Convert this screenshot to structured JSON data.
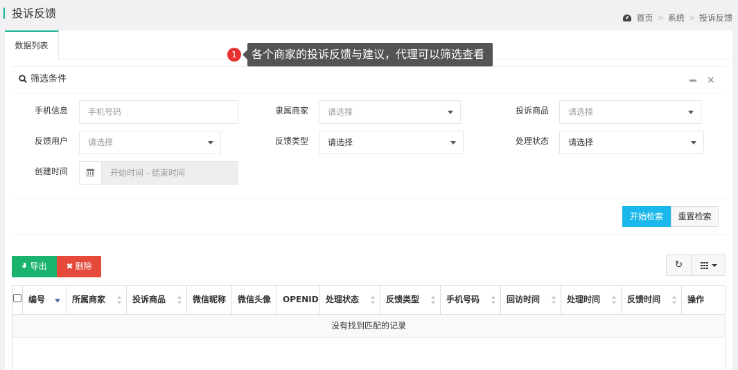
{
  "header": {
    "page_title": "投诉反馈",
    "breadcrumb": [
      "首页",
      "系统",
      "投诉反馈"
    ],
    "breadcrumb_sep": ">"
  },
  "tabs": [
    {
      "label": "数据列表"
    }
  ],
  "tooltip": {
    "badge": "1",
    "text": "各个商家的投诉反馈与建议，代理可以筛选查看"
  },
  "filter": {
    "title": "筛选条件",
    "minimize": "—",
    "close": "×",
    "fields": {
      "phone": {
        "label": "手机信息",
        "placeholder": "手机号码"
      },
      "merchant": {
        "label": "隶属商家",
        "value": "请选择"
      },
      "product": {
        "label": "投诉商品",
        "value": "请选择"
      },
      "user": {
        "label": "反馈用户",
        "value": "请选择"
      },
      "type": {
        "label": "反馈类型",
        "value": "请选择"
      },
      "status": {
        "label": "处理状态",
        "value": "请选择"
      },
      "created": {
        "label": "创建时间",
        "placeholder": "开始时间 - 结束时间"
      }
    },
    "search_button": "开始检索",
    "reset_button": "重置检索"
  },
  "toolbar": {
    "export_label": "导出",
    "delete_label": "删除",
    "refresh_icon": "↻"
  },
  "table": {
    "columns": [
      "编号",
      "所属商家",
      "投诉商品",
      "微信昵称",
      "微信头像",
      "OPENID",
      "处理状态",
      "反馈类型",
      "手机号码",
      "回访时间",
      "处理时间",
      "反馈时间",
      "操作"
    ],
    "empty_text": "没有找到匹配的记录"
  },
  "colors": {
    "accent_green": "#1ab394",
    "search_blue": "#1ab7ea",
    "export_green": "#1ab36e",
    "delete_red": "#e4493a",
    "badge_red": "#e8312f"
  }
}
